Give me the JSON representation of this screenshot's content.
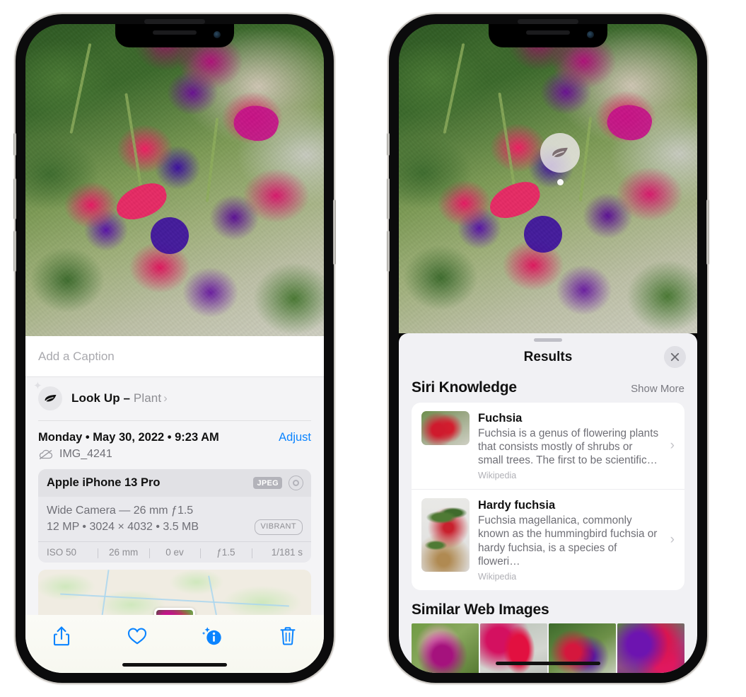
{
  "left_phone": {
    "caption_placeholder": "Add a Caption",
    "lookup": {
      "label": "Look Up –",
      "subject": "Plant",
      "chevron": "›",
      "icon": "leaf-icon",
      "sparkle": "✦"
    },
    "date": "Monday • May 30, 2022 • 9:23 AM",
    "adjust_label": "Adjust",
    "filename": "IMG_4241",
    "cloud_icon": "cloud-slash-icon",
    "exif": {
      "device": "Apple iPhone 13 Pro",
      "format_badge": "JPEG",
      "lens_icon": "camera-lens-icon",
      "lens_line": "Wide Camera — 26 mm ƒ1.5",
      "spec_line": "12 MP • 3024 × 4032 • 3.5 MB",
      "style_badge": "VIBRANT",
      "stats": [
        "ISO 50",
        "26 mm",
        "0 ev",
        "ƒ1.5",
        "1/181 s"
      ]
    },
    "toolbar": [
      {
        "name": "share-button",
        "icon": "share-icon"
      },
      {
        "name": "favorite-button",
        "icon": "heart-icon"
      },
      {
        "name": "info-button",
        "icon": "info-sparkle-icon"
      },
      {
        "name": "delete-button",
        "icon": "trash-icon"
      }
    ],
    "accent_color": "#0b84ff"
  },
  "right_phone": {
    "visual_lookup_badge": {
      "icon": "leaf-icon",
      "name": "visual-look-up-badge"
    },
    "sheet": {
      "title": "Results",
      "close_icon": "close-icon",
      "sections": [
        {
          "title": "Siri Knowledge",
          "action": "Show More",
          "items": [
            {
              "title": "Fuchsia",
              "description": "Fuchsia is a genus of flowering plants that consists mostly of shrubs or small trees. The first to be scientific…",
              "source": "Wikipedia"
            },
            {
              "title": "Hardy fuchsia",
              "description": "Fuchsia magellanica, commonly known as the hummingbird fuchsia or hardy fuchsia, is a species of floweri…",
              "source": "Wikipedia"
            }
          ]
        },
        {
          "title": "Similar Web Images",
          "images": [
            "fuchsia-web-image-1",
            "fuchsia-web-image-2",
            "fuchsia-web-image-3",
            "fuchsia-web-image-4"
          ]
        }
      ]
    }
  }
}
